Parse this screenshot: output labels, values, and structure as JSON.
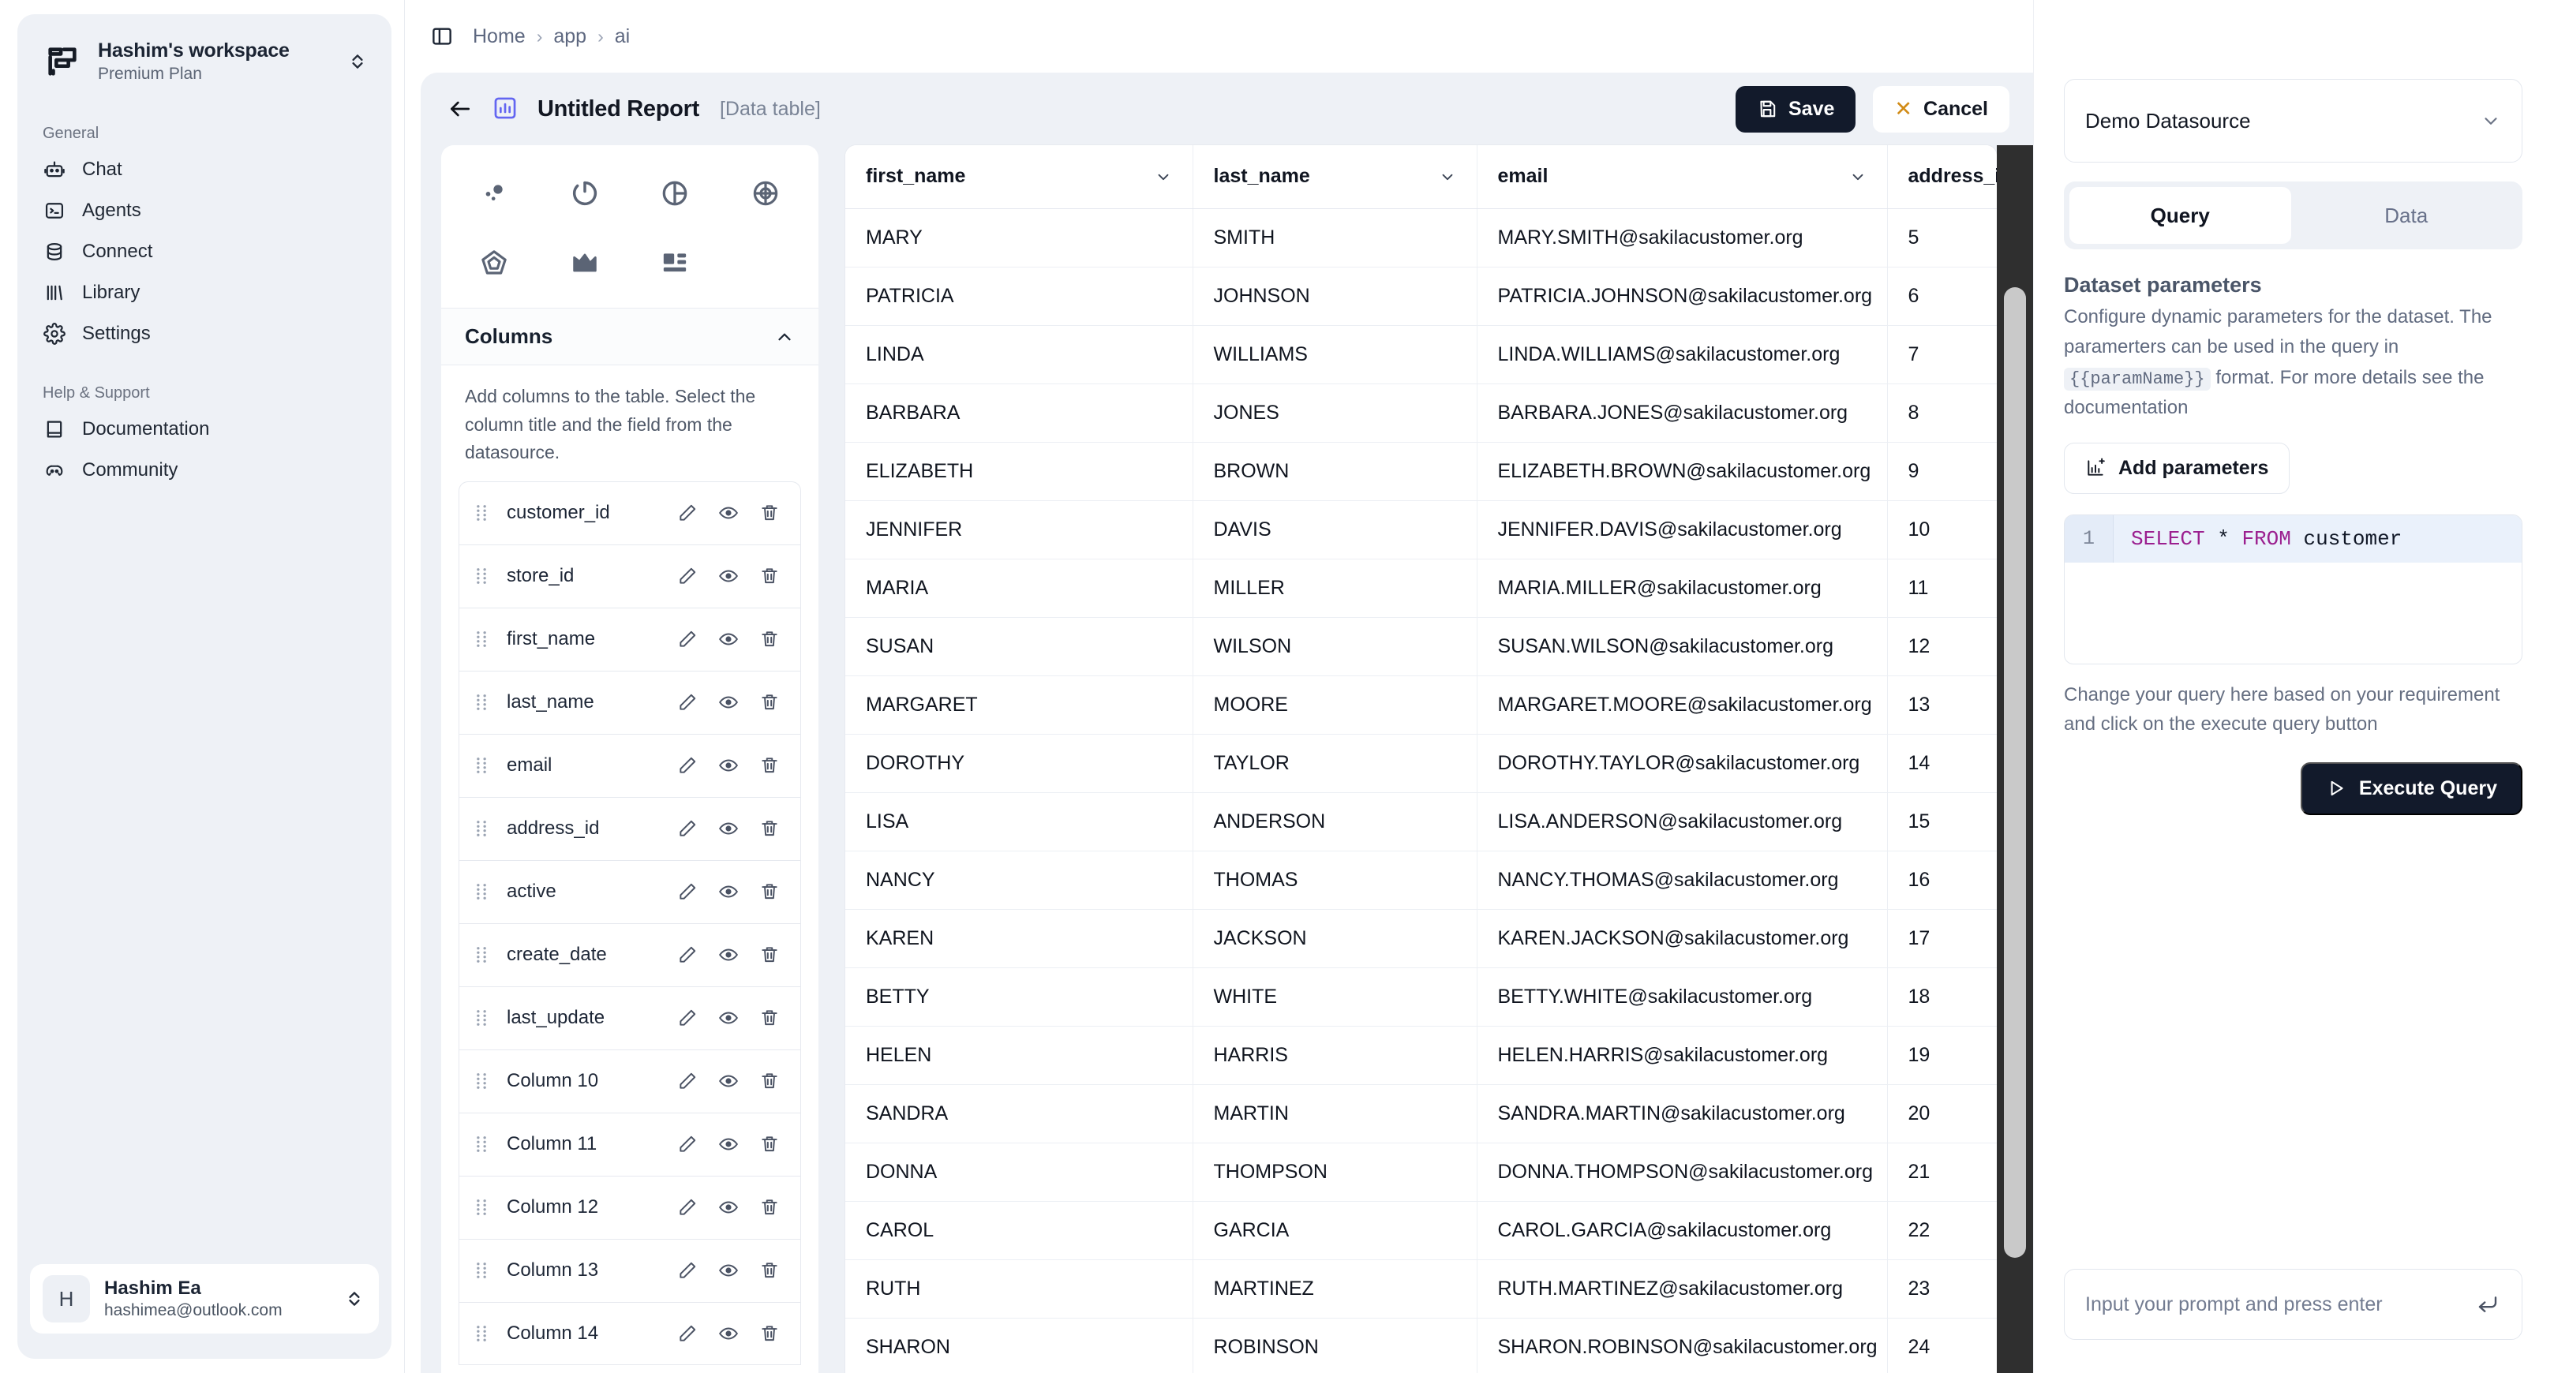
{
  "sidebar": {
    "workspace": {
      "name": "Hashim's workspace",
      "plan": "Premium Plan"
    },
    "sections": [
      {
        "label": "General",
        "items": [
          {
            "label": "Chat",
            "icon": "robot-icon"
          },
          {
            "label": "Agents",
            "icon": "terminal-icon"
          },
          {
            "label": "Connect",
            "icon": "database-icon"
          },
          {
            "label": "Library",
            "icon": "bars-icon"
          },
          {
            "label": "Settings",
            "icon": "gear-icon"
          }
        ]
      },
      {
        "label": "Help & Support",
        "items": [
          {
            "label": "Documentation",
            "icon": "book-icon"
          },
          {
            "label": "Community",
            "icon": "discord-icon"
          }
        ]
      }
    ],
    "user": {
      "initial": "H",
      "name": "Hashim Ea",
      "email": "hashimea@outlook.com"
    }
  },
  "topbar": {
    "breadcrumbs": [
      "Home",
      "app",
      "ai"
    ],
    "separator": "›"
  },
  "editor": {
    "title": "Untitled Report",
    "type_label": "[Data table]",
    "save_label": "Save",
    "cancel_label": "Cancel"
  },
  "config": {
    "chart_types": [
      "scatter-chart-icon",
      "donut-chart-icon",
      "pie-chart-icon",
      "radar-chart-icon",
      "pentagon-chart-icon",
      "area-chart-icon",
      "data-table-icon"
    ],
    "columns_section": {
      "title": "Columns",
      "description": "Add columns to the table. Select the column title and the field from the datasource."
    },
    "columns": [
      "customer_id",
      "store_id",
      "first_name",
      "last_name",
      "email",
      "address_id",
      "active",
      "create_date",
      "last_update",
      "Column 10",
      "Column 11",
      "Column 12",
      "Column 13",
      "Column 14"
    ],
    "row_actions": [
      "edit-icon",
      "eye-icon",
      "trash-icon"
    ]
  },
  "table": {
    "headers": [
      "first_name",
      "last_name",
      "email",
      "address_id"
    ],
    "rows": [
      [
        "MARY",
        "SMITH",
        "MARY.SMITH@sakilacustomer.org",
        "5"
      ],
      [
        "PATRICIA",
        "JOHNSON",
        "PATRICIA.JOHNSON@sakilacustomer.org",
        "6"
      ],
      [
        "LINDA",
        "WILLIAMS",
        "LINDA.WILLIAMS@sakilacustomer.org",
        "7"
      ],
      [
        "BARBARA",
        "JONES",
        "BARBARA.JONES@sakilacustomer.org",
        "8"
      ],
      [
        "ELIZABETH",
        "BROWN",
        "ELIZABETH.BROWN@sakilacustomer.org",
        "9"
      ],
      [
        "JENNIFER",
        "DAVIS",
        "JENNIFER.DAVIS@sakilacustomer.org",
        "10"
      ],
      [
        "MARIA",
        "MILLER",
        "MARIA.MILLER@sakilacustomer.org",
        "11"
      ],
      [
        "SUSAN",
        "WILSON",
        "SUSAN.WILSON@sakilacustomer.org",
        "12"
      ],
      [
        "MARGARET",
        "MOORE",
        "MARGARET.MOORE@sakilacustomer.org",
        "13"
      ],
      [
        "DOROTHY",
        "TAYLOR",
        "DOROTHY.TAYLOR@sakilacustomer.org",
        "14"
      ],
      [
        "LISA",
        "ANDERSON",
        "LISA.ANDERSON@sakilacustomer.org",
        "15"
      ],
      [
        "NANCY",
        "THOMAS",
        "NANCY.THOMAS@sakilacustomer.org",
        "16"
      ],
      [
        "KAREN",
        "JACKSON",
        "KAREN.JACKSON@sakilacustomer.org",
        "17"
      ],
      [
        "BETTY",
        "WHITE",
        "BETTY.WHITE@sakilacustomer.org",
        "18"
      ],
      [
        "HELEN",
        "HARRIS",
        "HELEN.HARRIS@sakilacustomer.org",
        "19"
      ],
      [
        "SANDRA",
        "MARTIN",
        "SANDRA.MARTIN@sakilacustomer.org",
        "20"
      ],
      [
        "DONNA",
        "THOMPSON",
        "DONNA.THOMPSON@sakilacustomer.org",
        "21"
      ],
      [
        "CAROL",
        "GARCIA",
        "CAROL.GARCIA@sakilacustomer.org",
        "22"
      ],
      [
        "RUTH",
        "MARTINEZ",
        "RUTH.MARTINEZ@sakilacustomer.org",
        "23"
      ],
      [
        "SHARON",
        "ROBINSON",
        "SHARON.ROBINSON@sakilacustomer.org",
        "24"
      ]
    ]
  },
  "right": {
    "datasource": "Demo Datasource",
    "tabs": [
      {
        "label": "Query",
        "active": true
      },
      {
        "label": "Data",
        "active": false
      }
    ],
    "params": {
      "title": "Dataset parameters",
      "desc_1": "Configure dynamic parameters for the dataset. The paramerters can be used in the query in",
      "code_chip": "{{paramName}}",
      "desc_2": "format. For more details see the documentation",
      "add_label": "Add parameters"
    },
    "sql": {
      "line_number": "1",
      "kw1": "SELECT",
      "star": "*",
      "kw2": "FROM",
      "table": "customer",
      "hint": "Change your query here based on your requirement and click on the execute query button",
      "execute_label": "Execute Query"
    },
    "prompt_placeholder": "Input your prompt and press enter"
  },
  "colors": {
    "accent": "#6366f1",
    "dark_button": "#121a2b",
    "cancel_x": "#d18b16",
    "sidebar_bg": "#eef1f6",
    "sql_keyword": "#9b1f8f"
  }
}
